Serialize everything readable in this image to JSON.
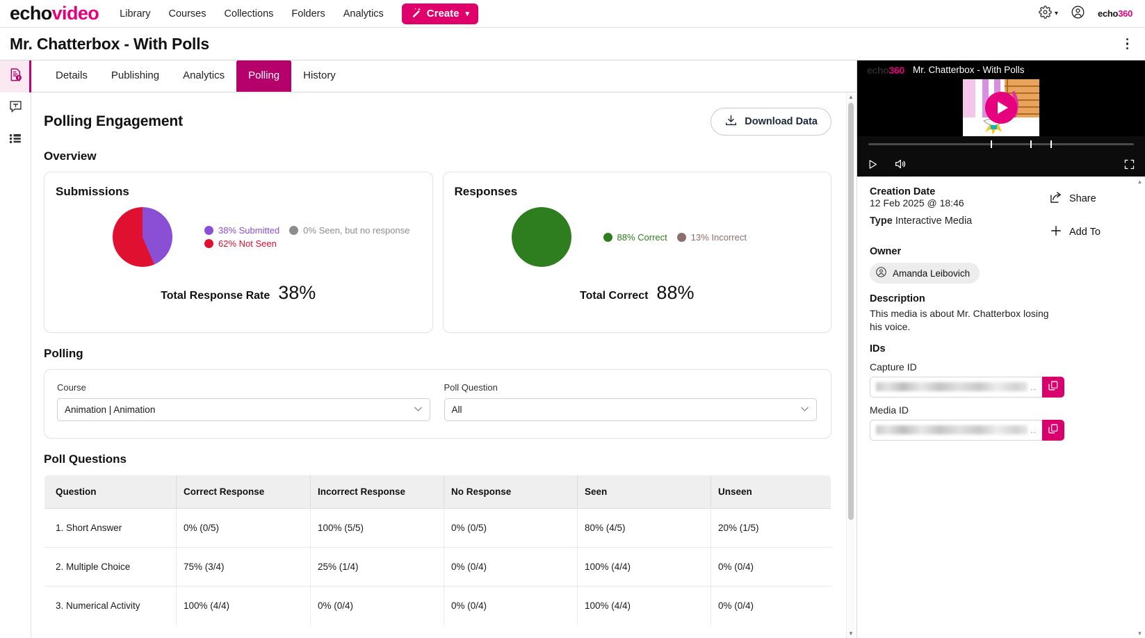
{
  "topnav": {
    "brand_echo": "echo",
    "brand_video": "video",
    "links": [
      {
        "label": "Library"
      },
      {
        "label": "Courses"
      },
      {
        "label": "Collections"
      },
      {
        "label": "Folders"
      },
      {
        "label": "Analytics"
      }
    ],
    "create_label": "Create",
    "create_chevron": "▾",
    "gear_chevron": "▾",
    "logo_a": "echo",
    "logo_b": "360"
  },
  "titlebar": {
    "title": "Mr. Chatterbox - With Polls"
  },
  "rail": {
    "items": [
      {
        "name": "media-info-icon"
      },
      {
        "name": "transcript-icon"
      },
      {
        "name": "chapters-icon"
      }
    ]
  },
  "tabs": [
    {
      "label": "Details",
      "active": false
    },
    {
      "label": "Publishing",
      "active": false
    },
    {
      "label": "Analytics",
      "active": false
    },
    {
      "label": "Polling",
      "active": true
    },
    {
      "label": "History",
      "active": false
    }
  ],
  "main": {
    "heading": "Polling Engagement",
    "download_label": "Download Data",
    "overview_heading": "Overview",
    "polling_heading": "Polling",
    "poll_questions_heading": "Poll Questions"
  },
  "chart_data": [
    {
      "type": "pie",
      "title": "Submissions",
      "categories": [
        "38% Submitted",
        "0% Seen, but no response",
        "62% Not Seen"
      ],
      "values": [
        38,
        0,
        62
      ],
      "colors": [
        "#8a4fd4",
        "#8d8d8d",
        "#e01030"
      ],
      "legend_position": "right",
      "total_label": "Total Response Rate",
      "total_value": "38%"
    },
    {
      "type": "pie",
      "title": "Responses",
      "categories": [
        "88% Correct",
        "13% Incorrect"
      ],
      "values": [
        88,
        13
      ],
      "colors": [
        "#2e7d1e",
        "#8d6e6e"
      ],
      "legend_position": "right",
      "total_label": "Total Correct",
      "total_value": "88%"
    }
  ],
  "filters": {
    "course": {
      "label": "Course",
      "value": "Animation | Animation",
      "chevron": "⌄"
    },
    "poll_question": {
      "label": "Poll Question",
      "value": "All",
      "chevron": "⌄"
    }
  },
  "table": {
    "columns": [
      "Question",
      "Correct Response",
      "Incorrect Response",
      "No Response",
      "Seen",
      "Unseen"
    ],
    "rows": [
      {
        "question": "1. Short Answer",
        "correct": "0% (0/5)",
        "incorrect": "100% (5/5)",
        "no_response": "0% (0/5)",
        "seen": "80% (4/5)",
        "unseen": "20% (1/5)"
      },
      {
        "question": "2. Multiple Choice",
        "correct": "75% (3/4)",
        "incorrect": "25% (1/4)",
        "no_response": "0% (0/4)",
        "seen": "100% (4/4)",
        "unseen": "0% (0/4)"
      },
      {
        "question": "3. Numerical Activity",
        "correct": "100% (4/4)",
        "incorrect": "0% (0/4)",
        "no_response": "0% (0/4)",
        "seen": "100% (4/4)",
        "unseen": "0% (0/4)"
      }
    ]
  },
  "player": {
    "logo_a": "echo",
    "logo_b": "360",
    "title": "Mr. Chatterbox - With Polls"
  },
  "details": {
    "creation_date_label": "Creation Date",
    "creation_date_value": "12 Feb 2025 @ 18:46",
    "type_label": "Type",
    "type_value": "Interactive Media",
    "owner_label": "Owner",
    "owner_name": "Amanda Leibovich",
    "description_label": "Description",
    "description_value": "This media is about Mr. Chatterbox losing his voice.",
    "ids_label": "IDs",
    "capture_id_label": "Capture ID",
    "media_id_label": "Media ID",
    "id_ellipsis": "..",
    "share_label": "Share",
    "add_to_label": "Add To"
  },
  "colors": {
    "brand_pink": "#e0006c",
    "tab_active": "#b5006b",
    "copy_button": "#d9006e"
  }
}
